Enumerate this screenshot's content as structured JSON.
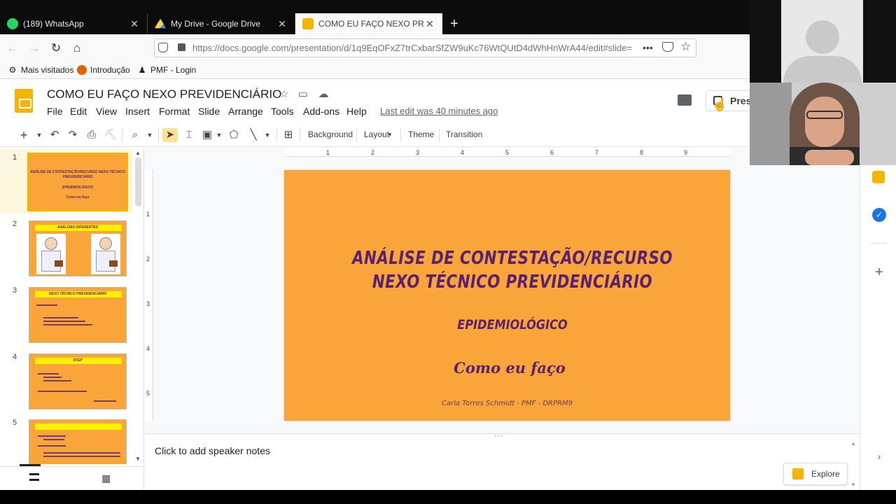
{
  "browser": {
    "tabs": [
      {
        "label": "(189) WhatsApp",
        "icon": "whatsapp-icon",
        "color": "#25d366"
      },
      {
        "label": "My Drive - Google Drive",
        "icon": "google-drive-icon",
        "color": "#1fa463"
      },
      {
        "label": "COMO EU FAÇO NEXO PREVID",
        "icon": "google-slides-icon",
        "color": "#f6b400"
      }
    ],
    "new_tab_label": "+",
    "url": "https://docs.google.com/presentation/d/1q9EqOFxZ7trCxbarSfZW9uKc76WtQUtD4dWhHnWrA44/edit#slide=",
    "bookmarks": [
      "Mais visitados",
      "Introdução",
      "PMF - Login"
    ]
  },
  "app": {
    "title": "COMO EU FAÇO NEXO PREVIDENCIÁRIO",
    "menus": [
      "File",
      "Edit",
      "View",
      "Insert",
      "Format",
      "Slide",
      "Arrange",
      "Tools",
      "Add-ons",
      "Help"
    ],
    "last_edit": "Last edit was 40 minutes ago",
    "present_label": "Pres",
    "toolbar": {
      "background": "Background",
      "layout": "Layout",
      "theme": "Theme",
      "transition": "Transition"
    }
  },
  "ruler": {
    "h": [
      "1",
      "2",
      "3",
      "4",
      "5",
      "6",
      "7",
      "8",
      "9"
    ],
    "v": [
      "1",
      "2",
      "3",
      "4",
      "5"
    ]
  },
  "filmstrip": {
    "slides": [
      {
        "num": "1",
        "title": "ANÁLISE DE CONTESTAÇÃO/RECURSO NEXO TÉCNICO PREVIDENCIÁRIO",
        "sub": "EPIDEMIOLÓGICO",
        "how": "Como eu faço"
      },
      {
        "num": "2",
        "title": "ANÁLISES DIFERENTES"
      },
      {
        "num": "3",
        "title": "NEXO TÉCNICO PREVIDENCIÁRIO"
      },
      {
        "num": "4",
        "title": "NTEP"
      },
      {
        "num": "5",
        "title": ""
      }
    ]
  },
  "slide": {
    "title_line1": "ANÁLISE DE CONTESTAÇÃO/RECURSO",
    "title_line2": "NEXO TÉCNICO PREVIDENCIÁRIO",
    "subtitle": "EPIDEMIOLÓGICO",
    "how": "Como eu faço",
    "author": "Carla Torres Schmidt - PMF - DRPRM9",
    "bg_color": "#f9a53a",
    "text_color": "#5a2170"
  },
  "notes": {
    "placeholder": "Click to add speaker notes"
  },
  "explore": {
    "label": "Explore"
  }
}
